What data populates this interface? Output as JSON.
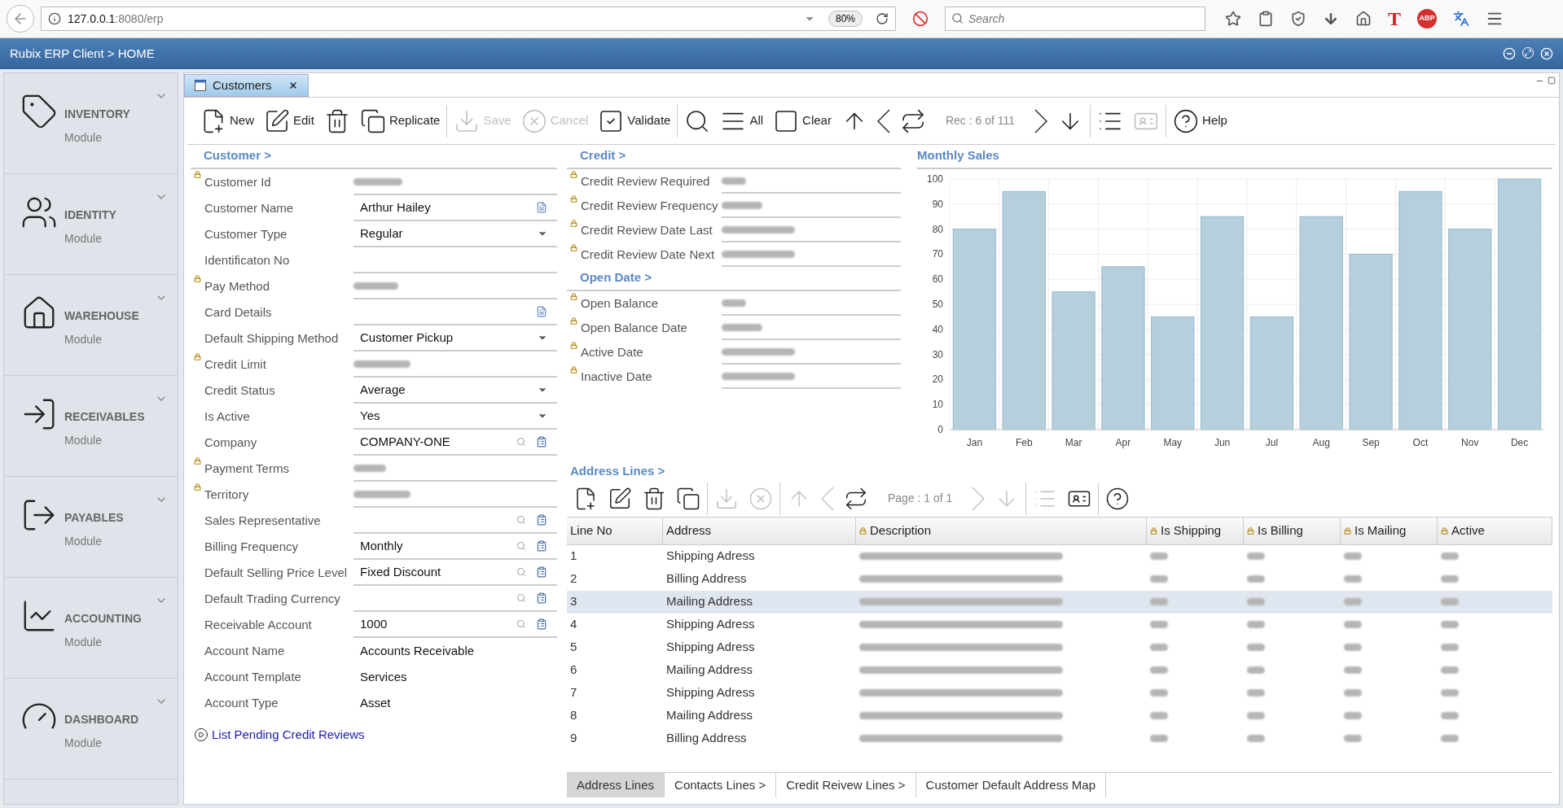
{
  "browser": {
    "url_host": "127.0.0.1",
    "url_rest": ":8080/erp",
    "zoom": "80%",
    "search_placeholder": "Search",
    "t_logo": "T",
    "abp_logo": "ABP"
  },
  "app_bar": {
    "title": "Rubix ERP Client > HOME"
  },
  "sidebar": {
    "items": [
      {
        "kind": "tag",
        "title": "INVENTORY",
        "subtitle": "Module",
        "selected": false
      },
      {
        "kind": "users",
        "title": "IDENTITY",
        "subtitle": "Module",
        "selected": false
      },
      {
        "kind": "house",
        "title": "WAREHOUSE",
        "subtitle": "Module",
        "selected": false
      },
      {
        "kind": "login",
        "title": "RECEIVABLES",
        "subtitle": "Module",
        "selected": false
      },
      {
        "kind": "logout",
        "title": "PAYABLES",
        "subtitle": "Module",
        "selected": false
      },
      {
        "kind": "chart",
        "title": "ACCOUNTING",
        "subtitle": "Module",
        "selected": false
      },
      {
        "kind": "gauge",
        "title": "DASHBOARD",
        "subtitle": "Module",
        "selected": false
      }
    ]
  },
  "tabs": [
    {
      "label": "Customers",
      "selected": true
    }
  ],
  "toolbar": {
    "groups": [
      [
        {
          "kind": "new",
          "label": "New",
          "disabled": false
        },
        {
          "kind": "edit",
          "label": "Edit",
          "disabled": false
        },
        {
          "kind": "delete",
          "disabled": false
        },
        {
          "kind": "replicate",
          "label": "Replicate",
          "disabled": false
        }
      ],
      [
        {
          "kind": "save",
          "label": "Save",
          "disabled": true
        },
        {
          "kind": "cancel",
          "label": "Cancel",
          "disabled": true
        },
        {
          "kind": "validate",
          "label": "Validate",
          "disabled": false
        }
      ],
      [
        {
          "kind": "search",
          "disabled": false
        },
        {
          "kind": "all",
          "label": "All",
          "disabled": false
        },
        {
          "kind": "clear",
          "label": "Clear",
          "disabled": false
        },
        {
          "kind": "up",
          "disabled": false
        },
        {
          "kind": "prev",
          "disabled": false
        },
        {
          "kind": "refresh",
          "disabled": false
        },
        {
          "kind": "counter",
          "label": "Rec : 6 of 111"
        },
        {
          "kind": "next",
          "disabled": false
        },
        {
          "kind": "down",
          "disabled": false
        }
      ],
      [
        {
          "kind": "list",
          "disabled": false
        },
        {
          "kind": "form",
          "disabled": true
        }
      ],
      [
        {
          "kind": "help",
          "label": "Help",
          "disabled": false
        }
      ]
    ]
  },
  "customer": {
    "title": "Customer >",
    "fields": [
      {
        "label": "Customer Id",
        "locked": true,
        "kind": "redacted"
      },
      {
        "label": "Customer Name",
        "locked": false,
        "kind": "memo",
        "value": "Arthur Hailey"
      },
      {
        "label": "Customer Type",
        "locked": false,
        "kind": "select",
        "value": "Regular"
      },
      {
        "label": "Identificaton No",
        "locked": false,
        "kind": "text"
      },
      {
        "label": "Pay Method",
        "locked": true,
        "kind": "redacted"
      },
      {
        "label": "Card Details",
        "locked": false,
        "kind": "memo"
      },
      {
        "label": "Default Shipping Method",
        "locked": false,
        "kind": "select",
        "value": "Customer Pickup"
      },
      {
        "label": "Credit Limit",
        "locked": true,
        "kind": "redacted"
      },
      {
        "label": "Credit Status",
        "locked": false,
        "kind": "select",
        "value": "Average"
      },
      {
        "label": "Is Active",
        "locked": false,
        "kind": "select",
        "value": "Yes"
      },
      {
        "label": "Company",
        "locked": false,
        "kind": "lookup",
        "value": "COMPANY-ONE"
      },
      {
        "label": "Payment Terms",
        "locked": true,
        "kind": "redacted"
      },
      {
        "label": "Territory",
        "locked": true,
        "kind": "redacted"
      },
      {
        "label": "Sales Representative",
        "locked": false,
        "kind": "lookup"
      },
      {
        "label": "Billing Frequency",
        "locked": false,
        "kind": "lookup",
        "value": "Monthly"
      },
      {
        "label": "Default Selling Price Level",
        "locked": false,
        "kind": "lookup",
        "value": "Fixed Discount"
      },
      {
        "label": "Default Trading Currency",
        "locked": false,
        "kind": "lookup"
      },
      {
        "label": "Receivable Account",
        "locked": false,
        "kind": "lookup",
        "value": "1000"
      },
      {
        "label": "Account Name",
        "locked": false,
        "kind": "plain",
        "value": "Accounts Receivable"
      },
      {
        "label": "Account Template",
        "locked": false,
        "kind": "plain",
        "value": "Services"
      },
      {
        "label": "Account Type",
        "locked": false,
        "kind": "plain",
        "value": "Asset"
      }
    ],
    "link": "List Pending Credit Reviews"
  },
  "credit_sections": [
    {
      "title": "Credit >",
      "fields": [
        {
          "label": "Credit Review Required",
          "locked": true
        },
        {
          "label": "Credit Review Frequency",
          "locked": true
        },
        {
          "label": "Credit Review Date Last",
          "locked": true
        },
        {
          "label": "Credit Review Date Next",
          "locked": true
        }
      ]
    },
    {
      "title": "Open Date >",
      "fields": [
        {
          "label": "Open Balance",
          "locked": true
        },
        {
          "label": "Open Balance Date",
          "locked": true
        },
        {
          "label": "Active Date",
          "locked": true
        },
        {
          "label": "Inactive Date",
          "locked": true
        }
      ]
    }
  ],
  "monthly_sales": {
    "title": "Monthly Sales",
    "chart_data": {
      "type": "bar",
      "categories": [
        "Jan",
        "Feb",
        "Mar",
        "Apr",
        "May",
        "Jun",
        "Jul",
        "Aug",
        "Sep",
        "Oct",
        "Nov",
        "Dec"
      ],
      "series": [
        {
          "color": "#b5cfdc",
          "values": [
            80,
            95,
            55,
            65,
            45,
            85,
            45,
            85,
            70,
            95,
            80,
            100
          ]
        }
      ],
      "ylim": [
        0,
        100
      ],
      "yticks": [
        0,
        10,
        20,
        30,
        40,
        50,
        60,
        70,
        80,
        90,
        100
      ],
      "grid": true
    }
  },
  "address_lines": {
    "title": "Address Lines >",
    "toolbar": {
      "groups": [
        [
          {
            "kind": "new",
            "disabled": false
          },
          {
            "kind": "edit",
            "disabled": false
          },
          {
            "kind": "delete",
            "disabled": false
          },
          {
            "kind": "replicate",
            "disabled": false
          }
        ],
        [
          {
            "kind": "save",
            "disabled": true
          },
          {
            "kind": "cancel",
            "disabled": true
          }
        ],
        [
          {
            "kind": "up",
            "disabled": true
          },
          {
            "kind": "prev",
            "disabled": true
          },
          {
            "kind": "refresh",
            "disabled": false
          },
          {
            "kind": "counter",
            "label": "Page : 1 of 1"
          },
          {
            "kind": "next",
            "disabled": true
          },
          {
            "kind": "down",
            "disabled": true
          }
        ],
        [
          {
            "kind": "list",
            "disabled": true
          },
          {
            "kind": "form",
            "disabled": false
          }
        ],
        [
          {
            "kind": "help",
            "disabled": false
          }
        ]
      ]
    },
    "columns": [
      {
        "label": "Line No",
        "locked": false,
        "kind": "line_no"
      },
      {
        "label": "Address",
        "locked": false,
        "kind": "address"
      },
      {
        "label": "Description",
        "locked": true,
        "kind": "masked_long"
      },
      {
        "label": "Is Shipping",
        "locked": true,
        "kind": "masked_short"
      },
      {
        "label": "Is Billing",
        "locked": true,
        "kind": "masked_short"
      },
      {
        "label": "Is Mailing",
        "locked": true,
        "kind": "masked_short"
      },
      {
        "label": "Active",
        "locked": true,
        "kind": "masked_short"
      }
    ],
    "rows": [
      {
        "line_no": "1",
        "address": "Shipping Adress",
        "selected": false
      },
      {
        "line_no": "2",
        "address": "Billing Address",
        "selected": false
      },
      {
        "line_no": "3",
        "address": "Mailing Address",
        "selected": true
      },
      {
        "line_no": "4",
        "address": "Shipping Adress",
        "selected": false
      },
      {
        "line_no": "5",
        "address": "Shipping Adress",
        "selected": false
      },
      {
        "line_no": "6",
        "address": "Mailing Address",
        "selected": false
      },
      {
        "line_no": "7",
        "address": "Shipping Adress",
        "selected": false
      },
      {
        "line_no": "8",
        "address": "Mailing Address",
        "selected": false
      },
      {
        "line_no": "9",
        "address": "Billing Address",
        "selected": false
      }
    ]
  },
  "bottom_tabs": [
    {
      "label": "Address Lines",
      "selected": true
    },
    {
      "label": "Contacts Lines >",
      "selected": false
    },
    {
      "label": "Credit Reivew Lines >",
      "selected": false
    },
    {
      "label": "Customer Default Address Map",
      "selected": false
    }
  ]
}
